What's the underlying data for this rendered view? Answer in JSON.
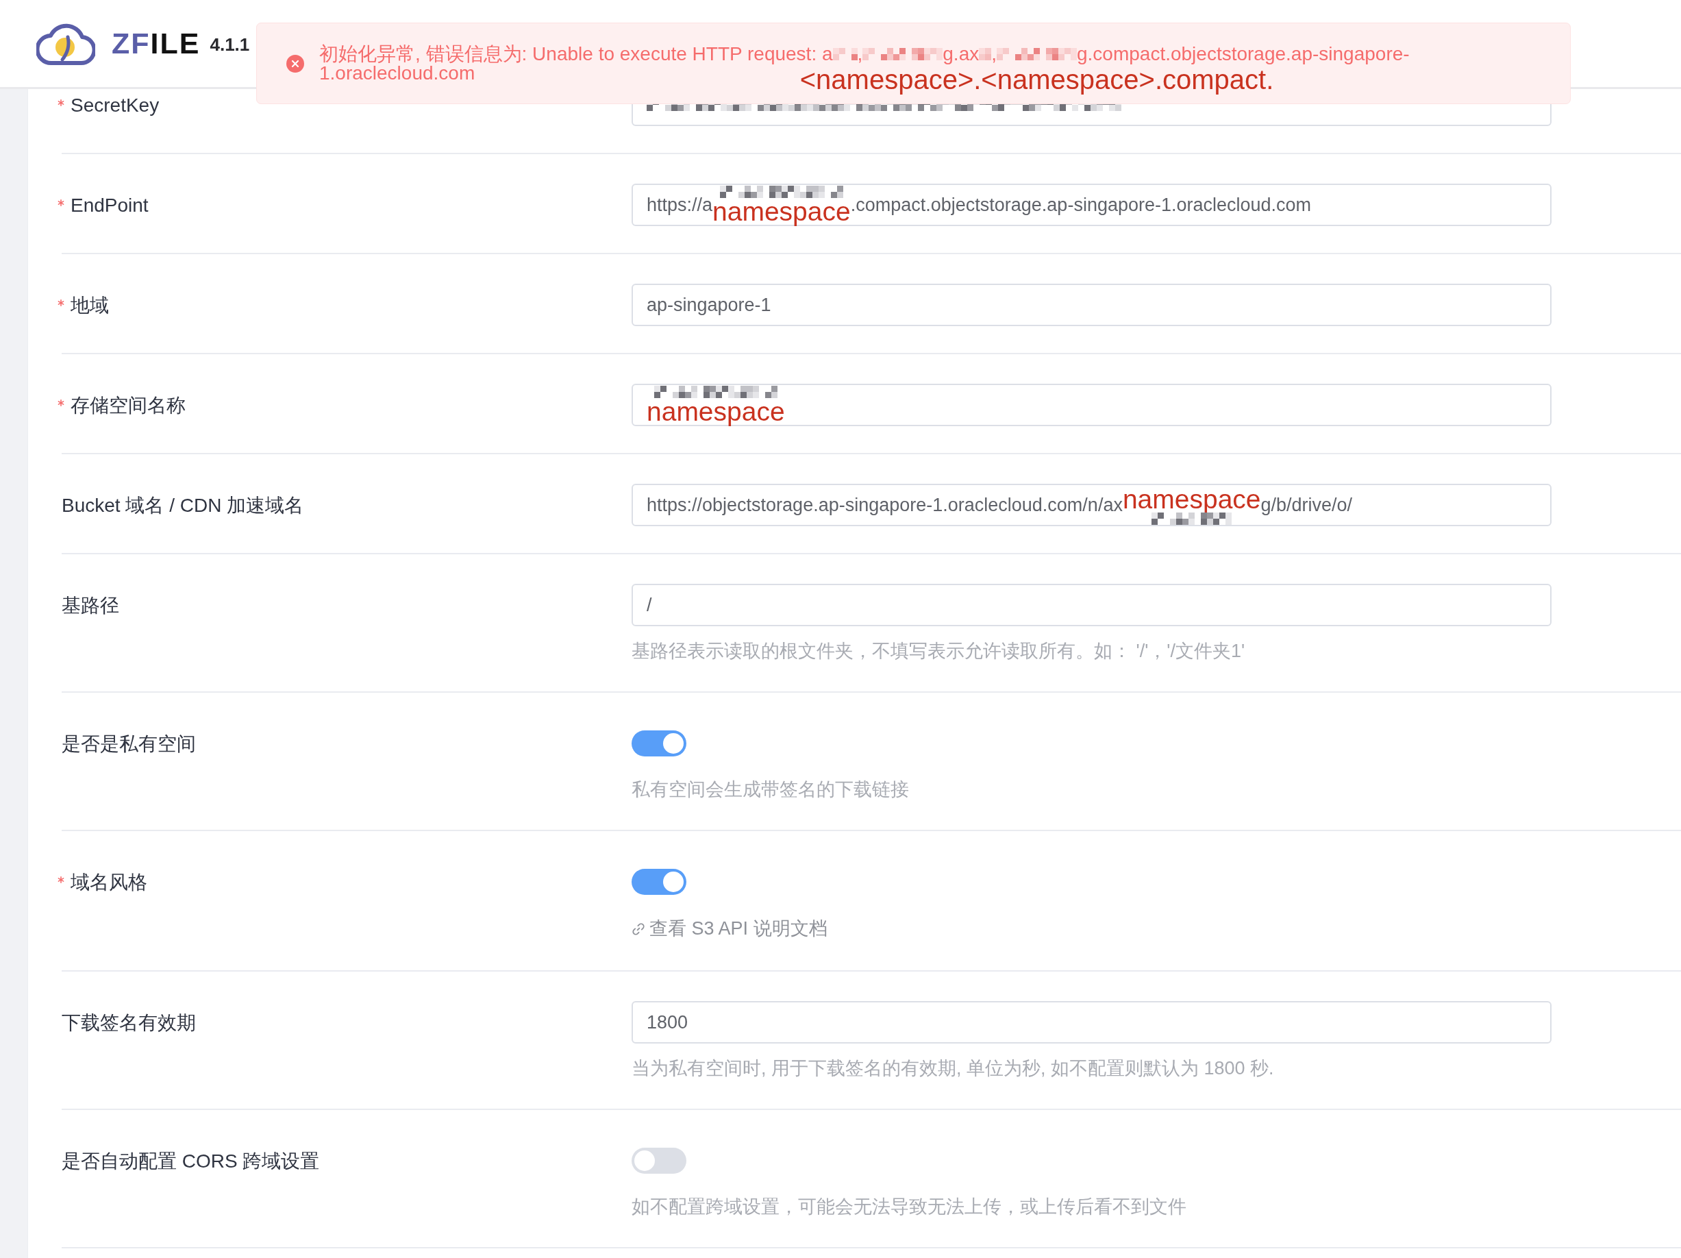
{
  "header": {
    "logo_parts": [
      "ZF",
      "ILE"
    ],
    "version": "4.1.1"
  },
  "toast": {
    "kind": "error",
    "lines": [
      [
        {
          "kind": "text",
          "text": "初始化异常, 错误信息为: Unable to execute HTTP request: a"
        },
        {
          "kind": "mosaic_small"
        },
        {
          "kind": "text",
          "text": ","
        },
        {
          "kind": "mosaic_medium"
        },
        {
          "kind": "text",
          "text": "g.ax"
        },
        {
          "kind": "mosaic_tiny"
        },
        {
          "kind": "text",
          "text": ","
        },
        {
          "kind": "mosaic_medium",
          "annotation": {
            "kind": "hanging",
            "text": "<namespace>.<namespace>.compact."
          }
        },
        {
          "kind": "text",
          "text": "g.compact.objectstorage.ap-singapore-"
        }
      ],
      [
        {
          "kind": "text",
          "text": "1.oraclecloud.com"
        }
      ]
    ]
  },
  "form": {
    "rows": [
      {
        "label": "SecretKey",
        "required": true,
        "control": {
          "kind": "input",
          "parts": [
            {
              "kind": "mosaic_wide"
            }
          ]
        }
      },
      {
        "label": "EndPoint",
        "required": true,
        "control": {
          "kind": "input",
          "parts": [
            {
              "kind": "text",
              "text": "https://a"
            },
            {
              "kind": "mosaic_large",
              "annotation": {
                "kind": "below",
                "text": "namespace"
              }
            },
            {
              "kind": "text",
              "text": ".compact.objectstorage.ap-singapore-1.oraclecloud.com"
            }
          ]
        }
      },
      {
        "label": "地域",
        "required": true,
        "control": {
          "kind": "input",
          "parts": [
            {
              "kind": "text",
              "text": "ap-singapore-1"
            }
          ]
        }
      },
      {
        "label": "存储空间名称",
        "required": true,
        "control": {
          "kind": "input",
          "parts": [
            {
              "kind": "mosaic_large",
              "annotation": {
                "kind": "below",
                "text": "namespace"
              }
            }
          ]
        }
      },
      {
        "label": "Bucket 域名 / CDN 加速域名",
        "required": false,
        "control": {
          "kind": "input",
          "parts": [
            {
              "kind": "text",
              "text": "https://objectstorage.ap-singapore-1.oraclecloud.com/n/ax"
            },
            {
              "kind": "mosaic_medium",
              "annotation": {
                "kind": "above",
                "text": "namespace"
              }
            },
            {
              "kind": "text",
              "text": "g/b/drive/o/"
            }
          ]
        }
      },
      {
        "label": "基路径",
        "required": false,
        "control": {
          "kind": "input",
          "parts": [
            {
              "kind": "text",
              "text": "/"
            }
          ]
        },
        "help": {
          "kind": "text",
          "text": "基路径表示读取的根文件夹，不填写表示允许读取所有。如： '/'，'/文件夹1'"
        }
      },
      {
        "label": "是否是私有空间",
        "required": false,
        "control": {
          "kind": "switch",
          "on": true
        },
        "help": {
          "kind": "text",
          "text": "私有空间会生成带签名的下载链接"
        }
      },
      {
        "label": "域名风格",
        "required": true,
        "control": {
          "kind": "switch",
          "on": true
        },
        "help": {
          "kind": "link",
          "text": "查看 S3 API 说明文档"
        }
      },
      {
        "label": "下载签名有效期",
        "required": false,
        "control": {
          "kind": "input",
          "parts": [
            {
              "kind": "text",
              "text": "1800"
            }
          ]
        },
        "help": {
          "kind": "text",
          "text": "当为私有空间时, 用于下载签名的有效期, 单位为秒, 如不配置则默认为 1800 秒."
        }
      },
      {
        "label": "是否自动配置 CORS 跨域设置",
        "required": false,
        "control": {
          "kind": "switch",
          "on": false
        },
        "help": {
          "kind": "text",
          "text": "如不配置跨域设置，可能会无法导致无法上传，或上传后看不到文件"
        }
      }
    ]
  }
}
